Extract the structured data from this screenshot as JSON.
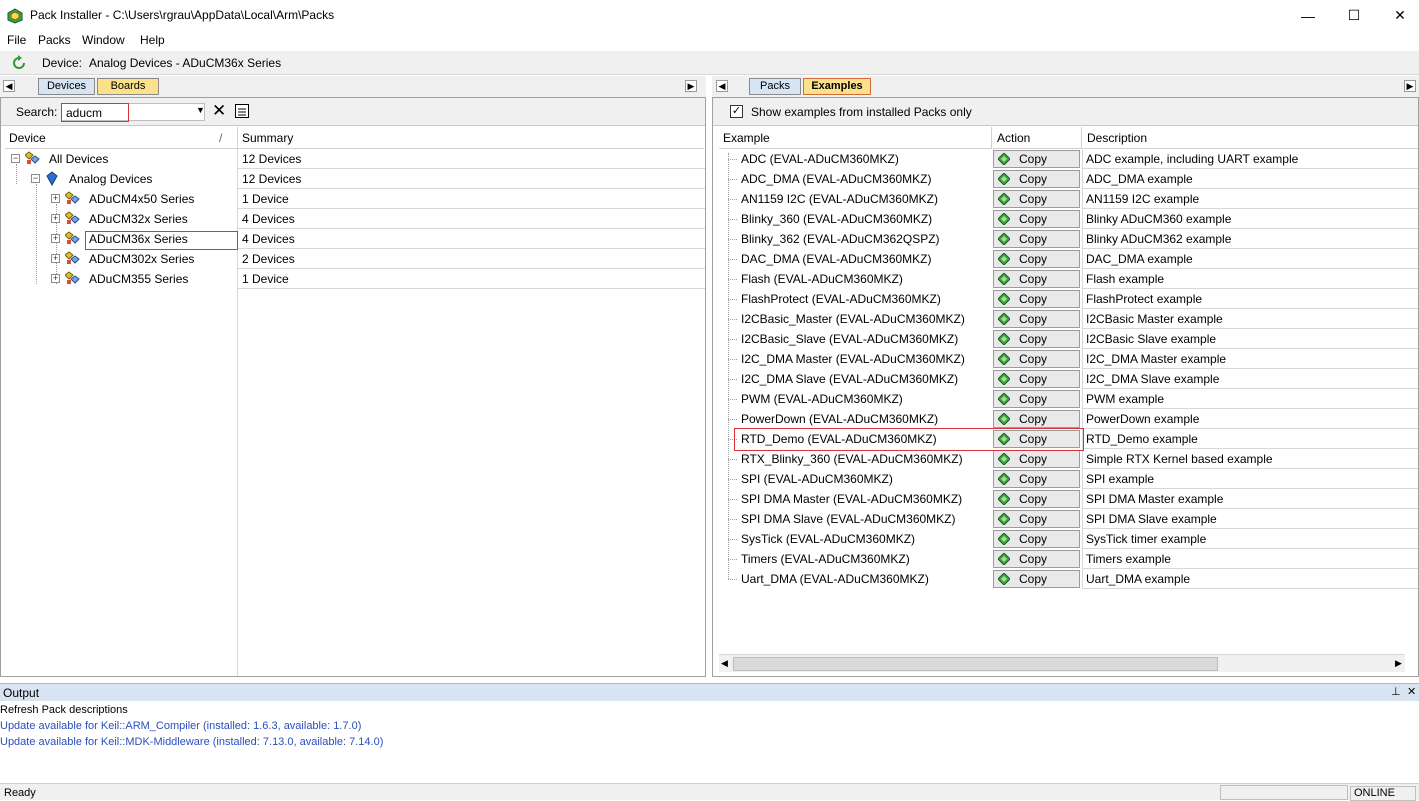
{
  "window": {
    "title": "Pack Installer - C:\\Users\\rgrau\\AppData\\Local\\Arm\\Packs",
    "minimize": "—",
    "maximize": "☐",
    "close": "✕"
  },
  "menu": [
    "File",
    "Packs",
    "Window",
    "Help"
  ],
  "device_bar": {
    "label": "Device:",
    "value": "Analog Devices - ADuCM36x Series",
    "icon": "refresh-icon"
  },
  "left_panel": {
    "tabs": [
      {
        "label": "Devices",
        "active": true
      },
      {
        "label": "Boards",
        "active": false
      }
    ],
    "search_label": "Search:",
    "search_value": "aducm",
    "columns": {
      "device": "Device",
      "summary": "Summary",
      "sort_mark": "/"
    },
    "tree": [
      {
        "label": "All Devices",
        "summary": "12 Devices",
        "level": 0,
        "expander": "−"
      },
      {
        "label": "Analog Devices",
        "summary": "12 Devices",
        "level": 1,
        "expander": "−"
      },
      {
        "label": "ADuCM4x50 Series",
        "summary": "1 Device",
        "level": 2,
        "expander": "+"
      },
      {
        "label": "ADuCM32x Series",
        "summary": "4 Devices",
        "level": 2,
        "expander": "+"
      },
      {
        "label": "ADuCM36x Series",
        "summary": "4 Devices",
        "level": 2,
        "expander": "+",
        "highlighted": true
      },
      {
        "label": "ADuCM302x Series",
        "summary": "2 Devices",
        "level": 2,
        "expander": "+"
      },
      {
        "label": "ADuCM355 Series",
        "summary": "1 Device",
        "level": 2,
        "expander": "+"
      }
    ]
  },
  "right_panel": {
    "tabs": [
      {
        "label": "Packs",
        "active": false
      },
      {
        "label": "Examples",
        "active": true
      }
    ],
    "show_installed_label": "Show examples from installed Packs only",
    "show_installed_checked": true,
    "columns": {
      "example": "Example",
      "action": "Action",
      "description": "Description"
    },
    "copy_label": "Copy",
    "examples": [
      {
        "name": "ADC (EVAL-ADuCM360MKZ)",
        "description": "ADC example, including UART example"
      },
      {
        "name": "ADC_DMA (EVAL-ADuCM360MKZ)",
        "description": "ADC_DMA example"
      },
      {
        "name": "AN1159 I2C (EVAL-ADuCM360MKZ)",
        "description": "AN1159 I2C example"
      },
      {
        "name": "Blinky_360 (EVAL-ADuCM360MKZ)",
        "description": "Blinky ADuCM360 example"
      },
      {
        "name": "Blinky_362 (EVAL-ADuCM362QSPZ)",
        "description": "Blinky ADuCM362 example"
      },
      {
        "name": "DAC_DMA (EVAL-ADuCM360MKZ)",
        "description": "DAC_DMA example"
      },
      {
        "name": "Flash (EVAL-ADuCM360MKZ)",
        "description": "Flash example"
      },
      {
        "name": "FlashProtect (EVAL-ADuCM360MKZ)",
        "description": "FlashProtect example"
      },
      {
        "name": "I2CBasic_Master (EVAL-ADuCM360MKZ)",
        "description": "I2CBasic Master example"
      },
      {
        "name": "I2CBasic_Slave (EVAL-ADuCM360MKZ)",
        "description": "I2CBasic Slave example"
      },
      {
        "name": "I2C_DMA Master (EVAL-ADuCM360MKZ)",
        "description": "I2C_DMA Master example"
      },
      {
        "name": "I2C_DMA Slave (EVAL-ADuCM360MKZ)",
        "description": "I2C_DMA Slave example"
      },
      {
        "name": "PWM (EVAL-ADuCM360MKZ)",
        "description": "PWM example"
      },
      {
        "name": "PowerDown (EVAL-ADuCM360MKZ)",
        "description": "PowerDown example"
      },
      {
        "name": "RTD_Demo (EVAL-ADuCM360MKZ)",
        "description": "RTD_Demo example",
        "highlighted": true
      },
      {
        "name": "RTX_Blinky_360 (EVAL-ADuCM360MKZ)",
        "description": "Simple RTX Kernel based example"
      },
      {
        "name": "SPI (EVAL-ADuCM360MKZ)",
        "description": "SPI example"
      },
      {
        "name": "SPI DMA Master (EVAL-ADuCM360MKZ)",
        "description": "SPI DMA Master example"
      },
      {
        "name": "SPI DMA Slave (EVAL-ADuCM360MKZ)",
        "description": "SPI DMA Slave example"
      },
      {
        "name": "SysTick (EVAL-ADuCM360MKZ)",
        "description": "SysTick timer example"
      },
      {
        "name": "Timers (EVAL-ADuCM360MKZ)",
        "description": "Timers example"
      },
      {
        "name": "Uart_DMA (EVAL-ADuCM360MKZ)",
        "description": "Uart_DMA example"
      }
    ]
  },
  "output": {
    "title": "Output",
    "lines": [
      {
        "text": "Refresh Pack descriptions",
        "color": "#000000"
      },
      {
        "text": "Update available for Keil::ARM_Compiler (installed: 1.6.3,  available: 1.7.0)",
        "color": "#2a4fbf"
      },
      {
        "text": "Update available for Keil::MDK-Middleware (installed: 7.13.0,  available: 7.14.0)",
        "color": "#2a4fbf"
      }
    ],
    "pin": "⊥",
    "close": "✕"
  },
  "status": {
    "left": "Ready",
    "right": "ONLINE"
  }
}
